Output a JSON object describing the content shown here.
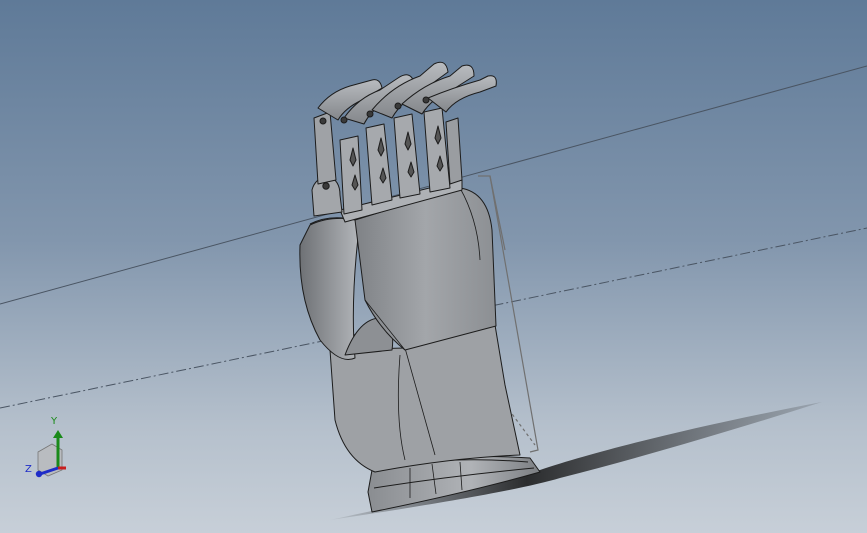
{
  "viewport": {
    "background_top": "#5f7a98",
    "background_bottom": "#c7cfd8"
  },
  "model": {
    "part_color": "#9a9da1",
    "edge_color": "#1c1c1c"
  },
  "triad": {
    "y_label": "Y",
    "z_label": "Z",
    "y_color": "#1a8a1a",
    "z_color": "#1e2cc8",
    "x_color": "#c81e1e"
  }
}
